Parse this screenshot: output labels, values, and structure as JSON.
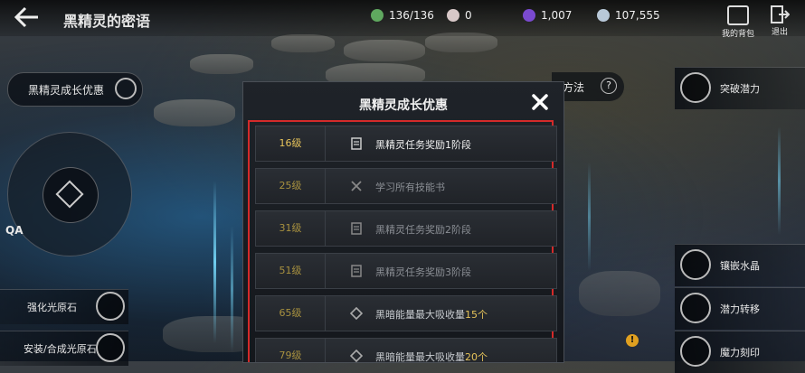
{
  "header": {
    "title": "黑精灵的密语",
    "resources": [
      {
        "icon": "energy-orb-icon",
        "value": "136/136",
        "color": "#5fa85f"
      },
      {
        "icon": "pearl-icon",
        "value": "0",
        "color": "#d8c8c8"
      },
      {
        "icon": "dark-gem-icon",
        "value": "1,007",
        "color": "#7a4ad0"
      },
      {
        "icon": "silver-coin-icon",
        "value": "107,555",
        "color": "#b8c8d8"
      }
    ],
    "backpack_label": "我的背包",
    "exit_label": "退出"
  },
  "left_panel": {
    "growth_button_label": "黑精灵成长优惠",
    "qa_label": "QA",
    "enhance_label": "强化光原石",
    "install_label": "安装/合成光原石"
  },
  "right_panel": {
    "method_label": "方法",
    "breakthrough_label": "突破潜力",
    "inlay_label": "镶嵌水晶",
    "transfer_label": "潜力转移",
    "engrave_label": "魔力刻印",
    "warning_badge": "!"
  },
  "modal": {
    "title": "黑精灵成长优惠",
    "rows": [
      {
        "level": "16级",
        "icon": "quest-scroll-icon",
        "text": "黑精灵任务奖励1阶段",
        "highlight": ""
      },
      {
        "level": "25级",
        "icon": "crossed-tools-icon",
        "text": "学习所有技能书",
        "highlight": ""
      },
      {
        "level": "31级",
        "icon": "quest-scroll-icon",
        "text": "黑精灵任务奖励2阶段",
        "highlight": ""
      },
      {
        "level": "51级",
        "icon": "quest-scroll-icon",
        "text": "黑精灵任务奖励3阶段",
        "highlight": ""
      },
      {
        "level": "65级",
        "icon": "diamond-rune-icon",
        "text": "黑暗能量最大吸收量",
        "highlight": "15个"
      },
      {
        "level": "79级",
        "icon": "diamond-rune-icon",
        "text": "黑暗能量最大吸收量",
        "highlight": "20个"
      }
    ]
  },
  "colors": {
    "highlight_frame": "#d42a2a",
    "level_gold": "#e6c35a"
  }
}
